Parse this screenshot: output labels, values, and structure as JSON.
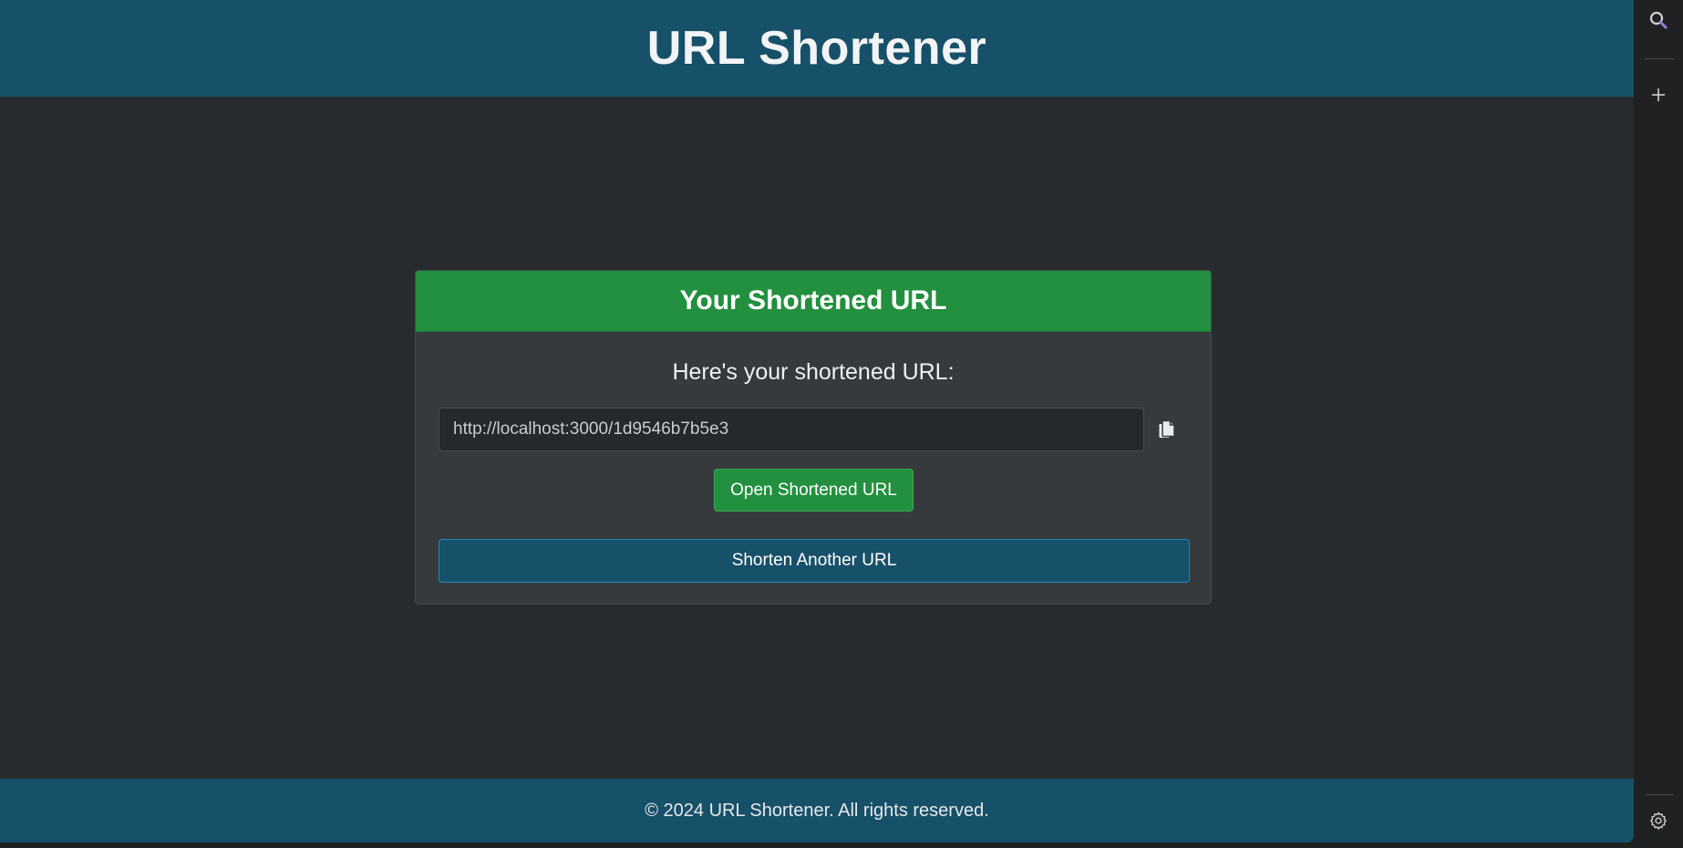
{
  "header": {
    "title": "URL Shortener"
  },
  "card": {
    "title": "Your Shortened URL",
    "lead": "Here's your shortened URL:",
    "short_url": "http://localhost:3000/1d9546b7b5e3",
    "copy_icon": "copy-icon",
    "open_label": "Open Shortened URL",
    "another_label": "Shorten Another URL"
  },
  "footer": {
    "text": "© 2024 URL Shortener. All rights reserved."
  },
  "side_rail": {
    "icons": [
      "search-icon",
      "plus-icon",
      "gear-icon"
    ]
  },
  "colors": {
    "header_bg": "#175069",
    "page_bg": "#282b2d",
    "card_bg": "#363a3d",
    "success": "#22903e"
  }
}
